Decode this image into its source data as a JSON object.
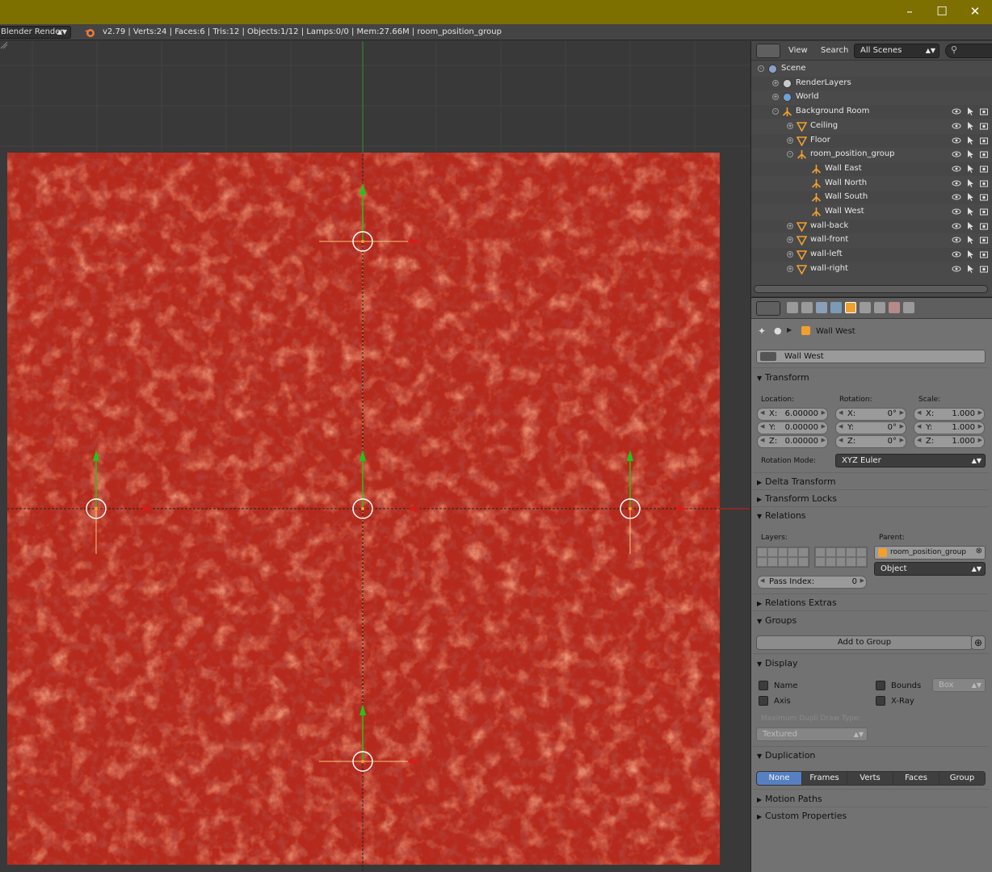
{
  "window": {
    "minimize_icon": "minimize-icon",
    "maximize_icon": "maximize-icon",
    "close_icon": "close-icon"
  },
  "infobar": {
    "engine": "Blender Render",
    "stats": "v2.79 | Verts:24 | Faces:6 | Tris:12 | Objects:1/12 | Lamps:0/0 | Mem:27.66M | room_position_group"
  },
  "outliner": {
    "view_label": "View",
    "search_label": "Search",
    "scenes_select": "All Scenes",
    "items": [
      {
        "label": "Scene",
        "icon": "scene-icon"
      },
      {
        "label": "RenderLayers",
        "icon": "render-layers-icon"
      },
      {
        "label": "World",
        "icon": "world-icon"
      },
      {
        "label": "Background Room",
        "icon": "empty-icon"
      },
      {
        "label": "Ceiling",
        "icon": "mesh-icon"
      },
      {
        "label": "Floor",
        "icon": "mesh-icon"
      },
      {
        "label": "room_position_group",
        "icon": "empty-icon"
      },
      {
        "label": "Wall East",
        "icon": "empty-icon"
      },
      {
        "label": "Wall North",
        "icon": "empty-icon"
      },
      {
        "label": "Wall South",
        "icon": "empty-icon"
      },
      {
        "label": "Wall West",
        "icon": "empty-icon"
      },
      {
        "label": "wall-back",
        "icon": "mesh-icon"
      },
      {
        "label": "wall-front",
        "icon": "mesh-icon"
      },
      {
        "label": "wall-left",
        "icon": "mesh-icon"
      },
      {
        "label": "wall-right",
        "icon": "mesh-icon"
      }
    ]
  },
  "properties": {
    "breadcrumb": "Wall West",
    "object_name": "Wall West",
    "transform": {
      "title": "Transform",
      "location_label": "Location:",
      "rotation_label": "Rotation:",
      "scale_label": "Scale:",
      "axis_x": "X:",
      "axis_y": "Y:",
      "axis_z": "Z:",
      "location": [
        "6.00000",
        "0.00000",
        "0.00000"
      ],
      "rotation": [
        "0°",
        "0°",
        "0°"
      ],
      "scale": [
        "1.000",
        "1.000",
        "1.000"
      ],
      "rotation_mode_label": "Rotation Mode:",
      "rotation_mode": "XYZ Euler"
    },
    "delta_transform": "Delta Transform",
    "transform_locks": "Transform Locks",
    "relations": {
      "title": "Relations",
      "layers_label": "Layers:",
      "parent_label": "Parent:",
      "parent_value": "room_position_group",
      "parent_type": "Object",
      "pass_index_label": "Pass Index:",
      "pass_index": "0"
    },
    "relations_extras": "Relations Extras",
    "groups": {
      "title": "Groups",
      "add_button": "Add to Group"
    },
    "display": {
      "title": "Display",
      "name_label": "Name",
      "axis_label": "Axis",
      "bounds_label": "Bounds",
      "xray_label": "X-Ray",
      "bounds_type": "Box",
      "max_dupli_label": "Maximum Dupli Draw Type:",
      "max_dupli_value": "Textured"
    },
    "duplication": {
      "title": "Duplication",
      "options": [
        "None",
        "Frames",
        "Verts",
        "Faces",
        "Group"
      ],
      "selected": "None"
    },
    "motion_paths": "Motion Paths",
    "custom_properties": "Custom Properties"
  },
  "colors": {
    "title_bar": "#7d7000",
    "wall_red": "#b52a1c",
    "axis_green": "#22c41a",
    "axis_red": "#e01818",
    "selected_tab": "#5680c2"
  }
}
